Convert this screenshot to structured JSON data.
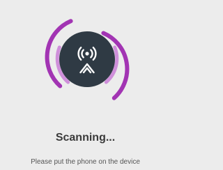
{
  "status": {
    "title": "Scanning...",
    "hint": "Please put the phone on the device"
  },
  "graphic": {
    "icon": "nfc-radio-icon",
    "center_color": "#2f3a44",
    "wave_outer_color": "#a234b3",
    "wave_inner_color": "#cf8fda",
    "icon_color": "#ffffff"
  }
}
